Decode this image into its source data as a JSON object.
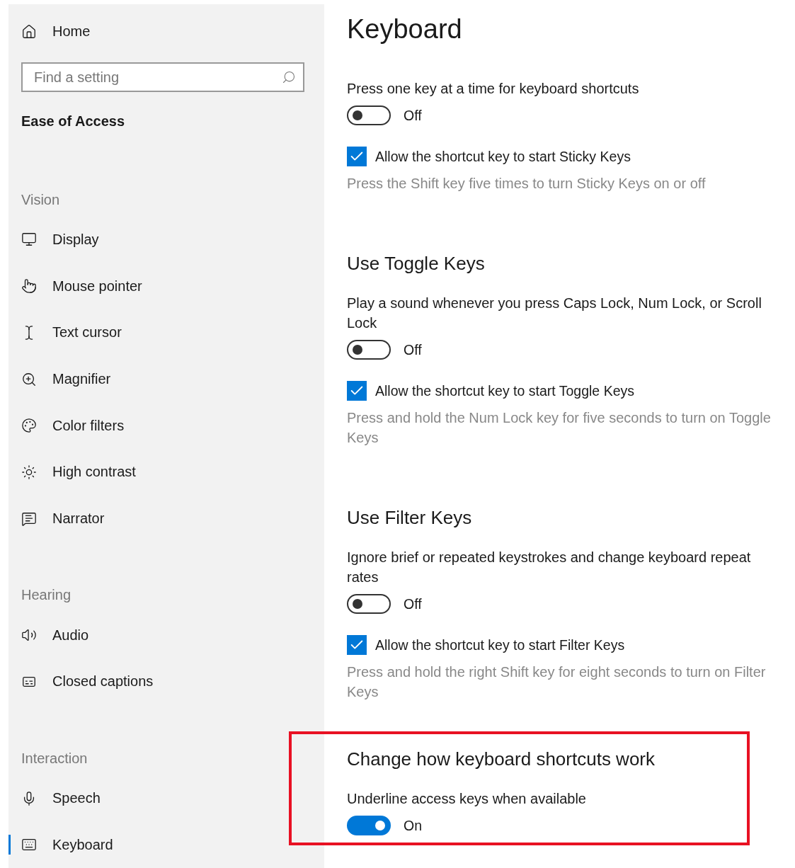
{
  "sidebar": {
    "home": "Home",
    "search": {
      "placeholder": "Find a setting"
    },
    "category": "Ease of Access",
    "groups": [
      {
        "heading": "Vision",
        "items": [
          {
            "label": "Display",
            "selected": false
          },
          {
            "label": "Mouse pointer",
            "selected": false
          },
          {
            "label": "Text cursor",
            "selected": false
          },
          {
            "label": "Magnifier",
            "selected": false
          },
          {
            "label": "Color filters",
            "selected": false
          },
          {
            "label": "High contrast",
            "selected": false
          },
          {
            "label": "Narrator",
            "selected": false
          }
        ]
      },
      {
        "heading": "Hearing",
        "items": [
          {
            "label": "Audio",
            "selected": false
          },
          {
            "label": "Closed captions",
            "selected": false
          }
        ]
      },
      {
        "heading": "Interaction",
        "items": [
          {
            "label": "Speech",
            "selected": false
          },
          {
            "label": "Keyboard",
            "selected": true
          }
        ]
      }
    ]
  },
  "page": {
    "title": "Keyboard",
    "sections": [
      {
        "description": "Press one key at a time for keyboard shortcuts",
        "toggle": {
          "on": false,
          "label": "Off"
        },
        "checkbox": {
          "checked": true,
          "label": "Allow the shortcut key to start Sticky Keys"
        },
        "hint": "Press the Shift key five times to turn Sticky Keys on or off"
      },
      {
        "heading": "Use Toggle Keys",
        "description": "Play a sound whenever you press Caps Lock, Num Lock, or Scroll Lock",
        "toggle": {
          "on": false,
          "label": "Off"
        },
        "checkbox": {
          "checked": true,
          "label": "Allow the shortcut key to start Toggle Keys"
        },
        "hint": "Press and hold the Num Lock key for five seconds to turn on Toggle Keys"
      },
      {
        "heading": "Use Filter Keys",
        "description": "Ignore brief or repeated keystrokes and change keyboard repeat rates",
        "toggle": {
          "on": false,
          "label": "Off"
        },
        "checkbox": {
          "checked": true,
          "label": "Allow the shortcut key to start Filter Keys"
        },
        "hint": "Press and hold the right Shift key for eight seconds to turn on Filter Keys"
      },
      {
        "heading": "Change how keyboard shortcuts work",
        "highlighted": true,
        "description": "Underline access keys when available",
        "toggle": {
          "on": true,
          "label": "On"
        }
      }
    ]
  }
}
